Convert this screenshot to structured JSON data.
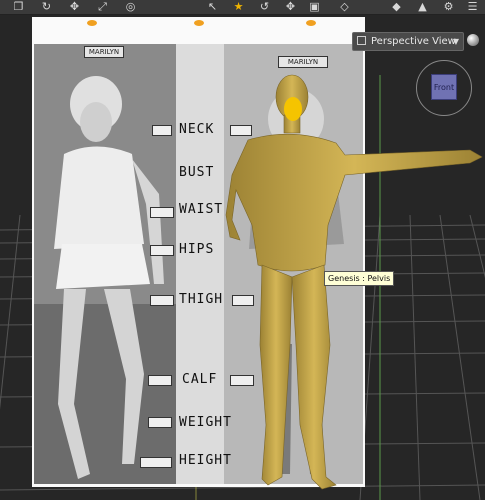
{
  "toolbar": {
    "icons": [
      "select-icon",
      "rotate-icon",
      "translate-icon",
      "scale-icon",
      "universal-icon",
      "node-select-icon",
      "active-pose-icon",
      "transform-icon",
      "move-icon",
      "joint-editor-icon",
      "surface-select-icon",
      "light-icon",
      "camera-icon",
      "render-icon"
    ],
    "active_icon": "active-pose-icon"
  },
  "viewport": {
    "view_selector_label": "Perspective View",
    "nav_cube_face": "Front",
    "tooltip": "Genesis : Pelvis"
  },
  "backdrop": {
    "left_name_tag": "MARILYN",
    "right_name_tag": "MARILYN",
    "measurements": [
      "NECK",
      "BUST",
      "WAIST",
      "HIPS",
      "THIGH",
      "CALF",
      "WEIGHT",
      "HEIGHT"
    ]
  },
  "colors": {
    "figure": "#c8a84a",
    "figure_highlight": "#e6c45a",
    "face_selected": "#f5c400",
    "tooltip_bg": "#ffffd6",
    "viewport_bg": "#262626"
  }
}
